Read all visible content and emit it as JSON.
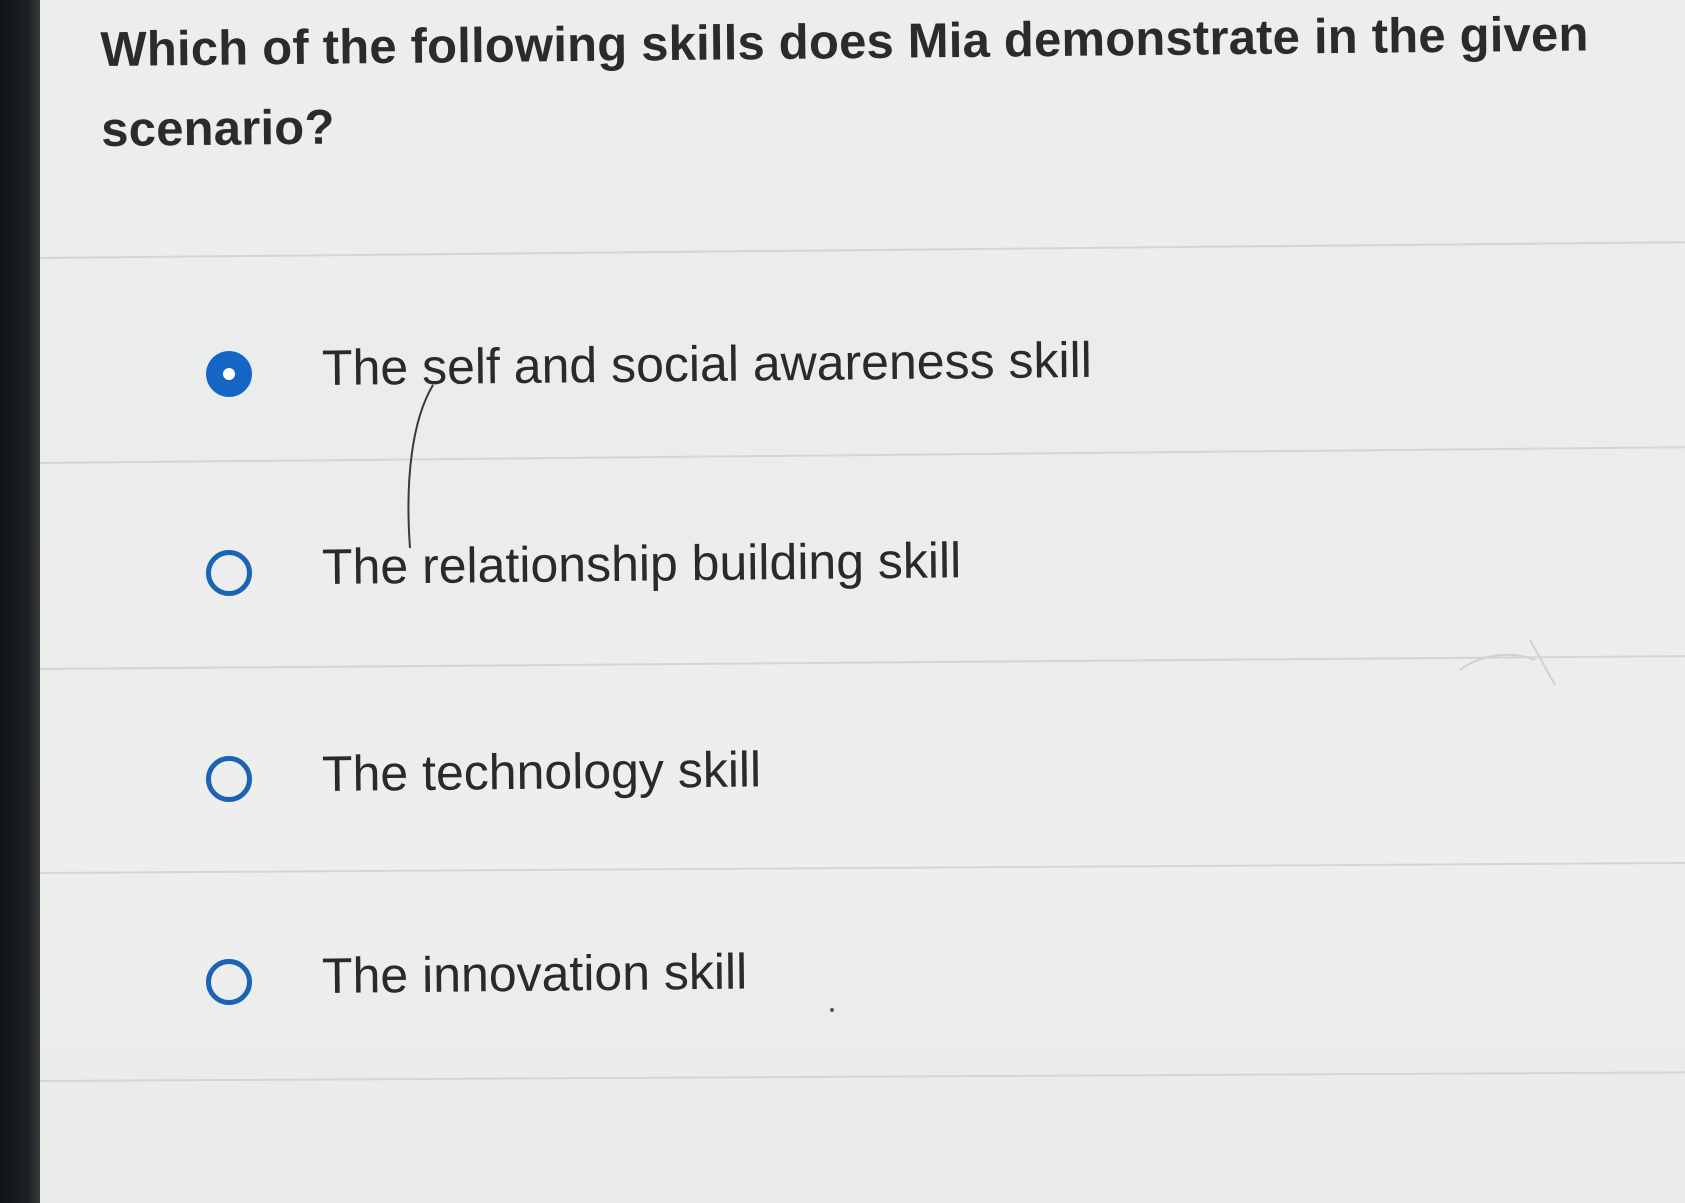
{
  "question": {
    "text": "Which of the following skills does Mia demonstrate in the given scenario?"
  },
  "options": [
    {
      "label": "The self and social awareness skill",
      "selected": true
    },
    {
      "label": "The relationship building skill",
      "selected": false
    },
    {
      "label": "The technology skill",
      "selected": false
    },
    {
      "label": "The innovation skill",
      "selected": false
    }
  ],
  "colors": {
    "accent": "#1565c6",
    "text": "#2a2a2a",
    "background": "#ebedec"
  }
}
